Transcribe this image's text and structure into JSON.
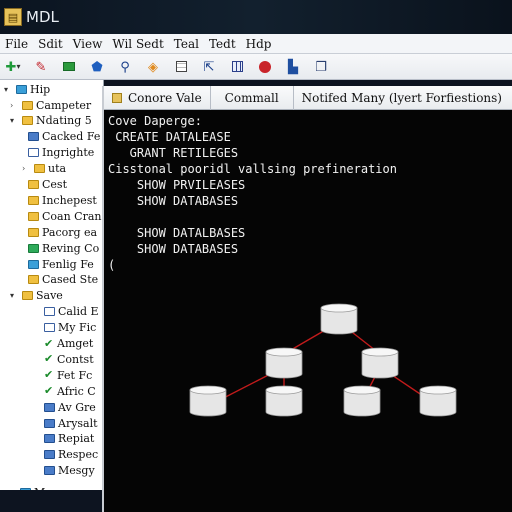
{
  "window": {
    "title": "MDL"
  },
  "menu": [
    "File",
    "Sdit",
    "View",
    "Wil Sedt",
    "Teal",
    "Tedt",
    "Hdp"
  ],
  "toolbar": {
    "icons": [
      "nav-arrows-icon",
      "edit-pencil-icon",
      "green-box-icon",
      "blue-shield-icon",
      "search-icon",
      "tag-icon",
      "grid-icon",
      "pointer-icon",
      "table-icon",
      "stop-icon",
      "chart-icon",
      "windows-icon"
    ]
  },
  "tree": {
    "root": "Hip",
    "items": [
      {
        "label": "Campeter",
        "icon": "folder",
        "indent": 1,
        "toggle": ">"
      },
      {
        "label": "Ndating 5",
        "icon": "folder",
        "indent": 1,
        "toggle": "v"
      },
      {
        "label": "Cacked Fe",
        "icon": "table",
        "indent": 2,
        "toggle": ""
      },
      {
        "label": "Ingrighte",
        "icon": "grid",
        "indent": 2,
        "toggle": ""
      },
      {
        "label": "uta",
        "icon": "folder",
        "indent": 2,
        "toggle": ">"
      },
      {
        "label": "Cest",
        "icon": "folder",
        "indent": 2,
        "toggle": ""
      },
      {
        "label": "Inchepest",
        "icon": "folder",
        "indent": 2,
        "toggle": ""
      },
      {
        "label": "Coan Cran",
        "icon": "folder",
        "indent": 2,
        "toggle": ""
      },
      {
        "label": "Pacorg ea",
        "icon": "folder",
        "indent": 2,
        "toggle": ""
      },
      {
        "label": "Reving Co",
        "icon": "green",
        "indent": 2,
        "toggle": ""
      },
      {
        "label": "Fenlig Fe",
        "icon": "db",
        "indent": 2,
        "toggle": ""
      },
      {
        "label": "Cased Ste",
        "icon": "folder",
        "indent": 2,
        "toggle": ""
      },
      {
        "label": "Save",
        "icon": "folder",
        "indent": 1,
        "toggle": "v"
      },
      {
        "label": "Calid E",
        "icon": "grid",
        "indent": 3,
        "toggle": ""
      },
      {
        "label": "My Fic",
        "icon": "grid",
        "indent": 3,
        "toggle": ""
      },
      {
        "label": "Amget",
        "icon": "check",
        "indent": 3,
        "toggle": ""
      },
      {
        "label": "Contst",
        "icon": "check",
        "indent": 3,
        "toggle": ""
      },
      {
        "label": "Fet Fc",
        "icon": "check",
        "indent": 3,
        "toggle": ""
      },
      {
        "label": "Afric C",
        "icon": "check",
        "indent": 3,
        "toggle": ""
      },
      {
        "label": "Av Gre",
        "icon": "table",
        "indent": 3,
        "toggle": ""
      },
      {
        "label": "Arysalt",
        "icon": "table",
        "indent": 3,
        "toggle": ""
      },
      {
        "label": "Repiat",
        "icon": "table",
        "indent": 3,
        "toggle": ""
      },
      {
        "label": "Respec",
        "icon": "table",
        "indent": 3,
        "toggle": ""
      },
      {
        "label": "Mesgy",
        "icon": "table",
        "indent": 3,
        "toggle": ""
      },
      {
        "label": "Monge",
        "icon": "db",
        "indent": 0,
        "toggle": "v"
      }
    ]
  },
  "terminal": {
    "tabs": [
      "Conore Vale",
      "Commall",
      "Notifed Many (lyert Forfiestions)"
    ],
    "lines": [
      "Cove Daperge:",
      " CREATE DATALEASE",
      "   GRANT RETILEGES",
      "Cisstonal pooridl vallsing prefineration",
      "    SHOW PRVILEASES",
      "    SHOW DATABASES",
      "",
      "    SHOW DATALBASES",
      "    SHOW DATABASES",
      "("
    ]
  },
  "diagram": {
    "nodes": [
      "root",
      "mid-left",
      "mid-right",
      "leaf-1",
      "leaf-2",
      "leaf-3",
      "leaf-4"
    ],
    "edge_color": "#c21b1b",
    "node_color": "#e6e6e6"
  }
}
